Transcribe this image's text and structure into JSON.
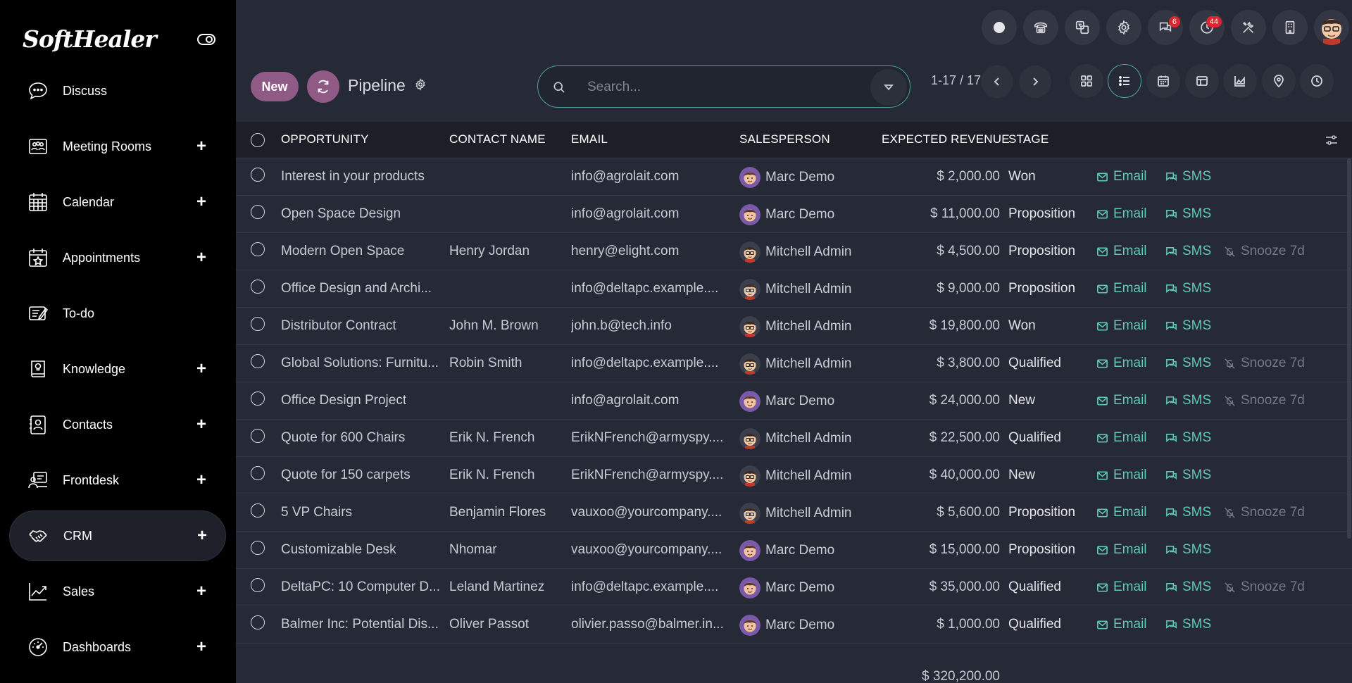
{
  "app": {
    "logo_text": "SoftHealer"
  },
  "sidebar": {
    "items": [
      {
        "label": "Discuss",
        "icon": "chat-bubble-icon",
        "has_plus": false,
        "active": false
      },
      {
        "label": "Meeting Rooms",
        "icon": "meeting-room-icon",
        "has_plus": true,
        "active": false
      },
      {
        "label": "Calendar",
        "icon": "calendar-icon",
        "has_plus": true,
        "active": false
      },
      {
        "label": "Appointments",
        "icon": "appointment-icon",
        "has_plus": true,
        "active": false
      },
      {
        "label": "To-do",
        "icon": "todo-icon",
        "has_plus": false,
        "active": false
      },
      {
        "label": "Knowledge",
        "icon": "knowledge-book-icon",
        "has_plus": true,
        "active": false
      },
      {
        "label": "Contacts",
        "icon": "contacts-icon",
        "has_plus": true,
        "active": false
      },
      {
        "label": "Frontdesk",
        "icon": "frontdesk-icon",
        "has_plus": true,
        "active": false
      },
      {
        "label": "CRM",
        "icon": "handshake-icon",
        "has_plus": true,
        "active": true
      },
      {
        "label": "Sales",
        "icon": "sales-chart-icon",
        "has_plus": true,
        "active": false
      },
      {
        "label": "Dashboards",
        "icon": "dashboard-gauge-icon",
        "has_plus": true,
        "active": false
      }
    ],
    "plus_symbol": "+"
  },
  "topbar": {
    "messages_badge": "6",
    "activities_badge": "44"
  },
  "controls": {
    "new_label": "New",
    "page_title": "Pipeline",
    "search_placeholder": "Search...",
    "pager_text": "1-17 / 17"
  },
  "table": {
    "headers": {
      "opportunity": "OPPORTUNITY",
      "contact": "CONTACT NAME",
      "email": "EMAIL",
      "salesperson": "SALESPERSON",
      "revenue": "EXPECTED REVENUE",
      "stage": "STAGE"
    },
    "action_email": "Email",
    "action_sms": "SMS",
    "action_snooze": "Snooze 7d",
    "rows": [
      {
        "opportunity": "Interest in your products",
        "contact": "",
        "email": "info@agrolait.com",
        "salesperson": "Marc Demo",
        "avatar": "marc",
        "revenue": "$ 2,000.00",
        "stage": "Won",
        "snooze": false
      },
      {
        "opportunity": "Open Space Design",
        "contact": "",
        "email": "info@agrolait.com",
        "salesperson": "Marc Demo",
        "avatar": "marc",
        "revenue": "$ 11,000.00",
        "stage": "Proposition",
        "snooze": false
      },
      {
        "opportunity": "Modern Open Space",
        "contact": "Henry Jordan",
        "email": "henry@elight.com",
        "salesperson": "Mitchell Admin",
        "avatar": "mitchell",
        "revenue": "$ 4,500.00",
        "stage": "Proposition",
        "snooze": true
      },
      {
        "opportunity": "Office Design and Archi...",
        "contact": "",
        "email": "info@deltapc.example....",
        "salesperson": "Mitchell Admin",
        "avatar": "mitchell",
        "revenue": "$ 9,000.00",
        "stage": "Proposition",
        "snooze": false
      },
      {
        "opportunity": "Distributor Contract",
        "contact": "John M. Brown",
        "email": "john.b@tech.info",
        "salesperson": "Mitchell Admin",
        "avatar": "mitchell",
        "revenue": "$ 19,800.00",
        "stage": "Won",
        "snooze": false
      },
      {
        "opportunity": "Global Solutions: Furnitu...",
        "contact": "Robin Smith",
        "email": "info@deltapc.example....",
        "salesperson": "Mitchell Admin",
        "avatar": "mitchell",
        "revenue": "$ 3,800.00",
        "stage": "Qualified",
        "snooze": true
      },
      {
        "opportunity": "Office Design Project",
        "contact": "",
        "email": "info@agrolait.com",
        "salesperson": "Marc Demo",
        "avatar": "marc",
        "revenue": "$ 24,000.00",
        "stage": "New",
        "snooze": true
      },
      {
        "opportunity": "Quote for 600 Chairs",
        "contact": "Erik N. French",
        "email": "ErikNFrench@armyspy....",
        "salesperson": "Mitchell Admin",
        "avatar": "mitchell",
        "revenue": "$ 22,500.00",
        "stage": "Qualified",
        "snooze": false
      },
      {
        "opportunity": "Quote for 150 carpets",
        "contact": "Erik N. French",
        "email": "ErikNFrench@armyspy....",
        "salesperson": "Mitchell Admin",
        "avatar": "mitchell",
        "revenue": "$ 40,000.00",
        "stage": "New",
        "snooze": false
      },
      {
        "opportunity": "5 VP Chairs",
        "contact": "Benjamin Flores",
        "email": "vauxoo@yourcompany....",
        "salesperson": "Mitchell Admin",
        "avatar": "mitchell",
        "revenue": "$ 5,600.00",
        "stage": "Proposition",
        "snooze": true
      },
      {
        "opportunity": "Customizable Desk",
        "contact": "Nhomar",
        "email": "vauxoo@yourcompany....",
        "salesperson": "Marc Demo",
        "avatar": "marc",
        "revenue": "$ 15,000.00",
        "stage": "Proposition",
        "snooze": false
      },
      {
        "opportunity": "DeltaPC: 10 Computer D...",
        "contact": "Leland Martinez",
        "email": "info@deltapc.example....",
        "salesperson": "Marc Demo",
        "avatar": "marc",
        "revenue": "$ 35,000.00",
        "stage": "Qualified",
        "snooze": true
      },
      {
        "opportunity": "Balmer Inc: Potential Dis...",
        "contact": "Oliver Passot",
        "email": "olivier.passo@balmer.in...",
        "salesperson": "Marc Demo",
        "avatar": "marc",
        "revenue": "$ 1,000.00",
        "stage": "Qualified",
        "snooze": false
      }
    ],
    "total_revenue": "$ 320,200.00"
  },
  "colors": {
    "accent": "#5fc8b8",
    "primary": "#8f5a85",
    "sidebar_bg": "#000000",
    "content_bg": "#262a36",
    "badge": "#d9262f"
  }
}
